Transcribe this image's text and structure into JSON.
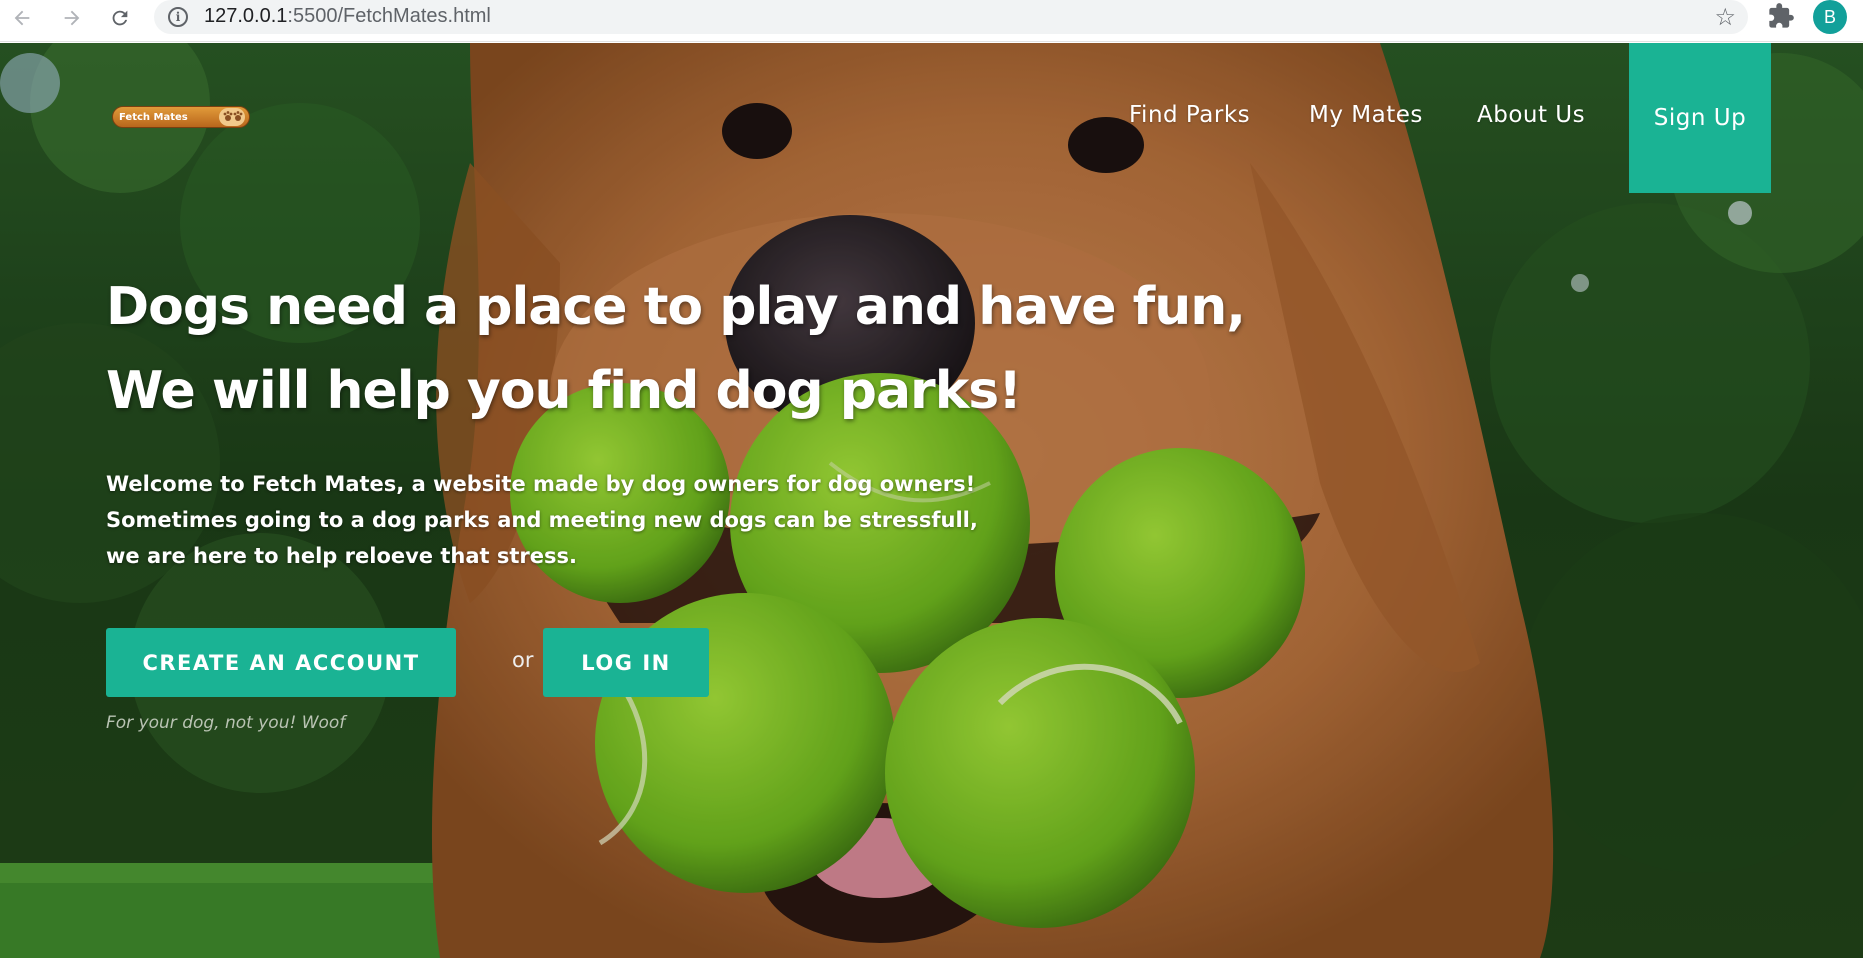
{
  "browser": {
    "url_host": "127.0.0.1",
    "url_rest": ":5500/FetchMates.html",
    "profile_initial": "B"
  },
  "icons": {
    "back": "arrow-left-icon",
    "forward": "arrow-right-icon",
    "reload": "reload-icon",
    "info": "info-icon",
    "bookmark": "star-icon",
    "extensions": "puzzle-icon"
  },
  "site": {
    "logo_text": "Fetch Mates",
    "nav": {
      "find_parks": "Find Parks",
      "my_mates": "My Mates",
      "about_us": "About Us",
      "sign_up": "Sign Up"
    },
    "hero": {
      "headline_line1": "Dogs need a place to play and have fun,",
      "headline_line2": "We will help you find dog parks!",
      "intro_line1": "Welcome to Fetch Mates, a website made by dog owners for dog owners!",
      "intro_line2": "Sometimes going to a dog parks and meeting new dogs can be stressfull,",
      "intro_line3": "we are here to help reloeve that stress.",
      "create_account": "CREATE AN ACCOUNT",
      "or": "or",
      "log_in": "LOG IN",
      "tagline": "For your dog, not you! Woof"
    }
  },
  "colors": {
    "accent": "#1ab394",
    "avatar": "#12a09a",
    "logo": "#c97a24"
  }
}
